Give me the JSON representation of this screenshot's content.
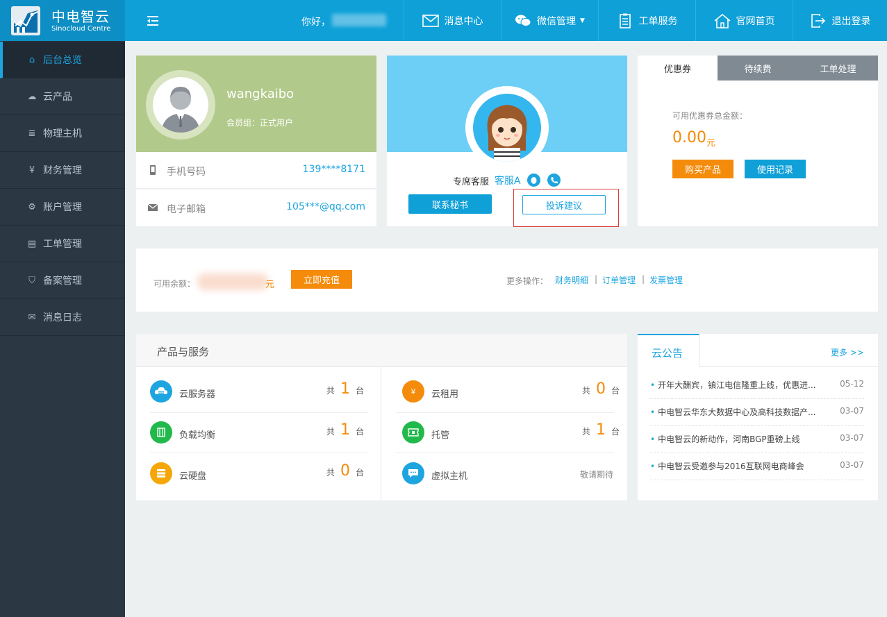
{
  "brand": {
    "name_cn": "中电智云",
    "name_en": "Sinocloud Centre"
  },
  "header": {
    "greeting": "你好，",
    "nav": [
      {
        "label": "消息中心",
        "icon": "envelope-icon"
      },
      {
        "label": "微信管理",
        "icon": "wechat-icon"
      },
      {
        "label": "工单服务",
        "icon": "clipboard-icon"
      },
      {
        "label": "官网首页",
        "icon": "home-icon"
      },
      {
        "label": "退出登录",
        "icon": "logout-icon"
      }
    ]
  },
  "sidebar": {
    "items": [
      {
        "label": "后台总览",
        "icon": "home-icon",
        "active": true
      },
      {
        "label": "云产品",
        "icon": "cloud-icon"
      },
      {
        "label": "物理主机",
        "icon": "server-icon"
      },
      {
        "label": "财务管理",
        "icon": "yen-icon"
      },
      {
        "label": "账户管理",
        "icon": "gears-icon"
      },
      {
        "label": "工单管理",
        "icon": "clipboard-icon"
      },
      {
        "label": "备案管理",
        "icon": "shield-icon"
      },
      {
        "label": "消息日志",
        "icon": "envelope-icon"
      }
    ]
  },
  "user": {
    "username": "wangkaibo",
    "member_group": "会员组：正式用户",
    "phone_label": "手机号码",
    "phone": "139****8171",
    "email_label": "电子邮箱",
    "email": "105***@qq.com"
  },
  "service": {
    "label": "专席客服",
    "name": "客服A",
    "contact_btn": "联系秘书",
    "complain_btn": "投诉建议"
  },
  "coupon": {
    "tabs": [
      "优惠券",
      "待续费",
      "工单处理"
    ],
    "total_label": "可用优惠券总金额：",
    "amount": "0.00",
    "unit": "元",
    "buy_btn": "购买产品",
    "usage_btn": "使用记录"
  },
  "balance": {
    "label": "可用余额：",
    "unit": "元",
    "recharge_btn": "立即充值",
    "more_ops_label": "更多操作：",
    "links": [
      "财务明细",
      "订单管理",
      "发票管理"
    ],
    "separator": "|"
  },
  "products": {
    "title": "产品与服务",
    "prefix": "共",
    "suffix": "台",
    "items": [
      {
        "name": "云服务器",
        "count": "1",
        "icon": "cloud-server-icon",
        "color": "#1da5e0"
      },
      {
        "name": "云租用",
        "count": "0",
        "icon": "money-bag-icon",
        "color": "#f58b0a"
      },
      {
        "name": "负载均衡",
        "count": "1",
        "icon": "load-balance-icon",
        "color": "#21b94b"
      },
      {
        "name": "托管",
        "count": "1",
        "icon": "hosting-icon",
        "color": "#21b94b"
      },
      {
        "name": "云硬盘",
        "count": "0",
        "icon": "disk-icon",
        "color": "#f5a70a"
      },
      {
        "name": "虚拟主机",
        "soon": "敬请期待",
        "icon": "chat-bubble-icon",
        "color": "#1da5e0"
      }
    ]
  },
  "notices": {
    "title": "云公告",
    "more": "更多 >>",
    "items": [
      {
        "title": "开年大酬宾，镇江电信隆重上线，优惠进...",
        "date": "05-12"
      },
      {
        "title": "中电智云华东大数据中心及高科技数据产...",
        "date": "03-07"
      },
      {
        "title": "中电智云的新动作，河南BGP重磅上线",
        "date": "03-07"
      },
      {
        "title": "中电智云受邀参与2016互联网电商峰会",
        "date": "03-07"
      }
    ]
  }
}
